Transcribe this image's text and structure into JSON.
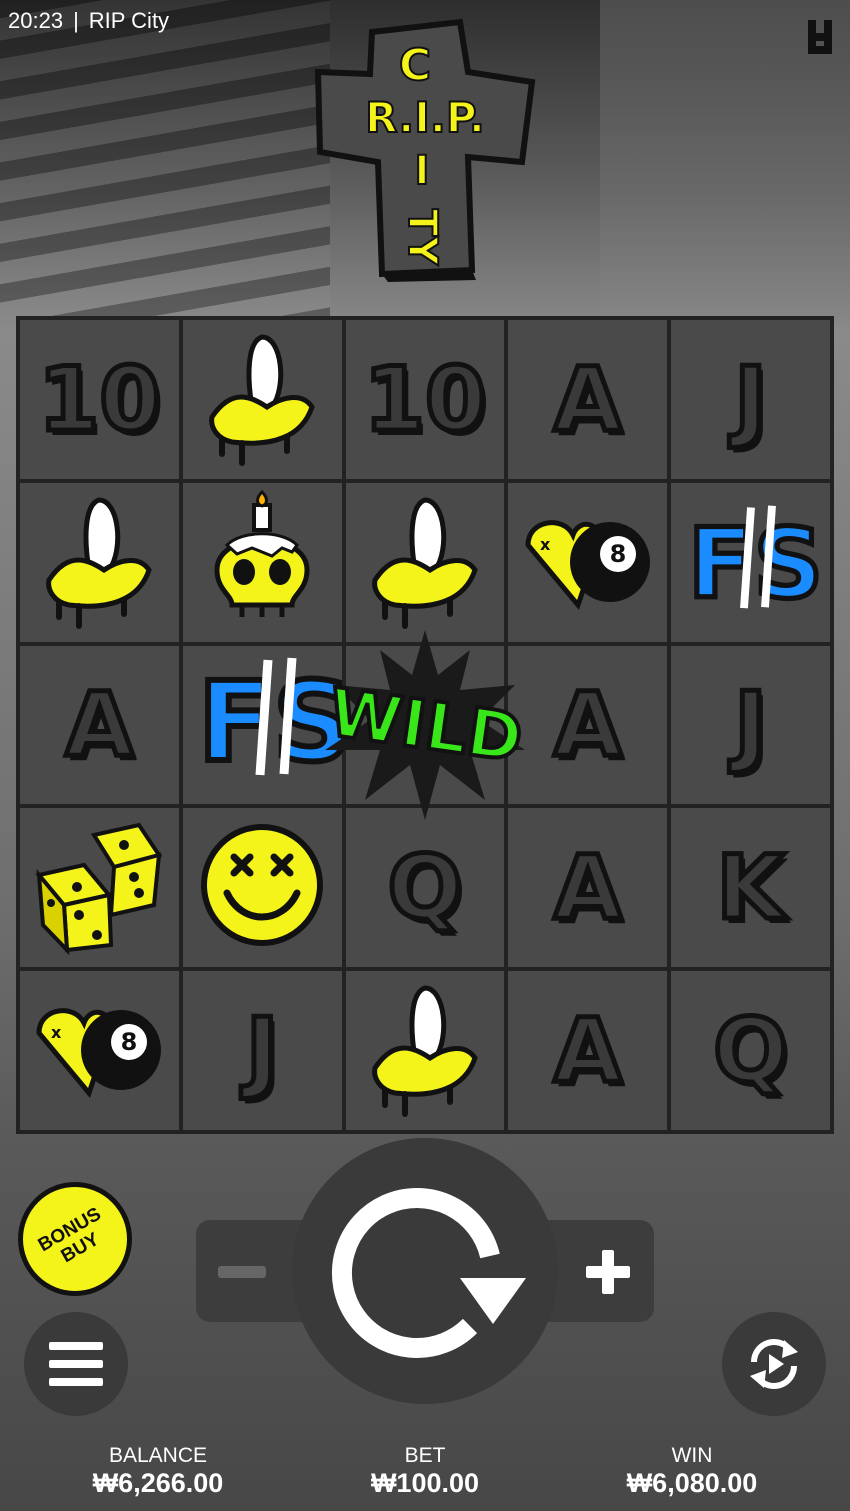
{
  "status": {
    "time": "20:23",
    "app_title": "RIP City"
  },
  "logo": {
    "line_horizontal": "R.I.P.",
    "line_vertical_top": "C",
    "line_vertical_bottom": "TY",
    "i_letter": "I"
  },
  "grid": [
    [
      "10",
      "banana",
      "10",
      "A",
      "J"
    ],
    [
      "banana",
      "skull-candle",
      "banana",
      "heart-8ball",
      "fs"
    ],
    [
      "A",
      "fs",
      "wild",
      "A",
      "J"
    ],
    [
      "dice",
      "smiley",
      "Q",
      "A",
      "K"
    ],
    [
      "heart-8ball",
      "J",
      "banana",
      "A",
      "Q"
    ]
  ],
  "wild_text": "WILD",
  "fs_text": "FS",
  "bonus_buy": {
    "label": "BONUS BUY"
  },
  "footer": {
    "balance_label": "BALANCE",
    "balance_value": "₩6,266.00",
    "bet_label": "BET",
    "bet_value": "₩100.00",
    "win_label": "WIN",
    "win_value": "₩6,080.00"
  },
  "colors": {
    "accent_yellow": "#f4f31a",
    "wild_green": "#39e61a",
    "fs_blue": "#1a8cff"
  },
  "icons": {
    "menu": "hamburger-icon",
    "spin": "spin-arrow-icon",
    "autoplay": "autoplay-icon",
    "provider": "hacksaw-logo-icon"
  }
}
